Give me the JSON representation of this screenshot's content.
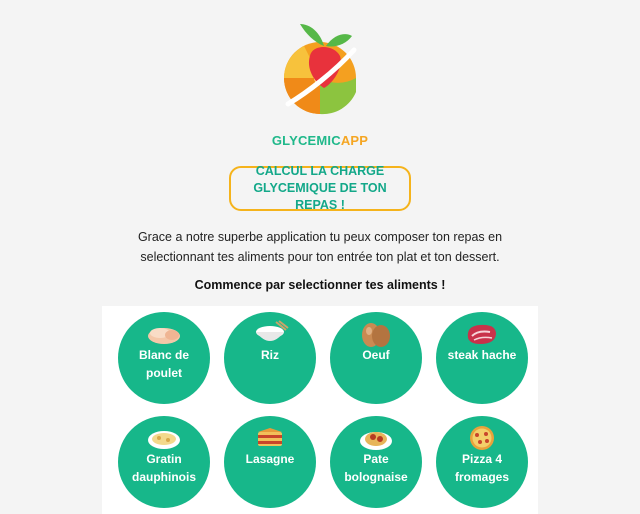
{
  "brand": {
    "part1": "GLYCEMIC",
    "part2": "APP"
  },
  "cta": {
    "line1": "CALCUL LA CHARGE",
    "line2": "GLYCEMIQUE DE TON REPAS !"
  },
  "intro": {
    "line1": "Grace a notre superbe application tu peux composer ton repas en",
    "line2": "selectionnant tes aliments pour ton entrée ton plat et ton dessert."
  },
  "prompt": "Commence par selectionner tes aliments !",
  "foods": [
    {
      "label": "Blanc de poulet",
      "icon": "chicken-icon"
    },
    {
      "label": "Riz",
      "icon": "rice-bowl-icon"
    },
    {
      "label": "Oeuf",
      "icon": "eggs-icon"
    },
    {
      "label": "steak hache",
      "icon": "steak-icon"
    },
    {
      "label": "Gratin dauphinois",
      "icon": "gratin-icon"
    },
    {
      "label": "Lasagne",
      "icon": "lasagna-icon"
    },
    {
      "label": "Pate bolognaise",
      "icon": "pasta-icon"
    },
    {
      "label": "Pizza 4 fromages",
      "icon": "pizza-icon"
    }
  ],
  "colors": {
    "accent": "#17b78a",
    "highlight": "#f5a623",
    "border": "#f5b31b"
  }
}
